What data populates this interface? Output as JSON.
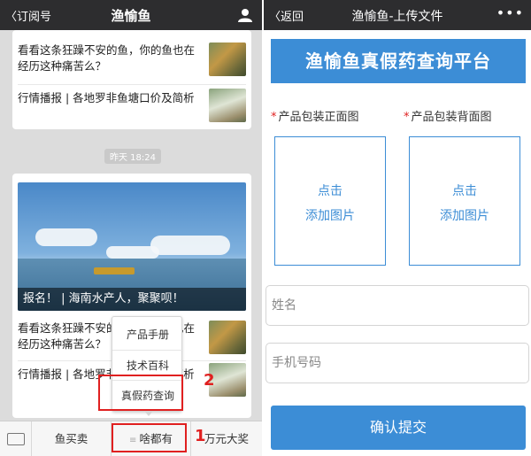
{
  "left_screen": {
    "header": {
      "back_label": "订阅号",
      "title": "渔愉鱼"
    },
    "articles_top": [
      {
        "title": "看看这条狂躁不安的鱼，你的鱼也在经历这种痛苦么？"
      },
      {
        "title": "行情播报 | 各地罗非鱼塘口价及简析"
      }
    ],
    "timestamp": "昨天 18:24",
    "feature": {
      "caption": "报名！ | 海南水产人，聚聚呗！"
    },
    "articles_bottom": [
      {
        "title": "看看这条狂躁不安的鱼，你的鱼也在经历这种痛苦么？"
      },
      {
        "title": "行情播报 | 各地罗非鱼塘口价及简析"
      }
    ],
    "popup_menu": [
      "产品手册",
      "技术百科",
      "真假药查询"
    ],
    "annotations": [
      "1",
      "2"
    ],
    "tabbar": [
      "鱼买卖",
      "啥都有",
      "万元大奖"
    ]
  },
  "right_screen": {
    "header": {
      "back_label": "返回",
      "title": "渔愉鱼-上传文件",
      "more": "•••"
    },
    "banner": "渔愉鱼真假药查询平台",
    "required_mark": "*",
    "upload_front": {
      "label": "产品包装正面图",
      "line1": "点击",
      "line2": "添加图片"
    },
    "upload_back": {
      "label": "产品包装背面图",
      "line1": "点击",
      "line2": "添加图片"
    },
    "name_placeholder": "姓名",
    "phone_placeholder": "手机号码",
    "submit_label": "确认提交"
  },
  "colors": {
    "accent": "#3c8dd6",
    "highlight": "#e02020",
    "topbar": "#2d2d2f"
  }
}
